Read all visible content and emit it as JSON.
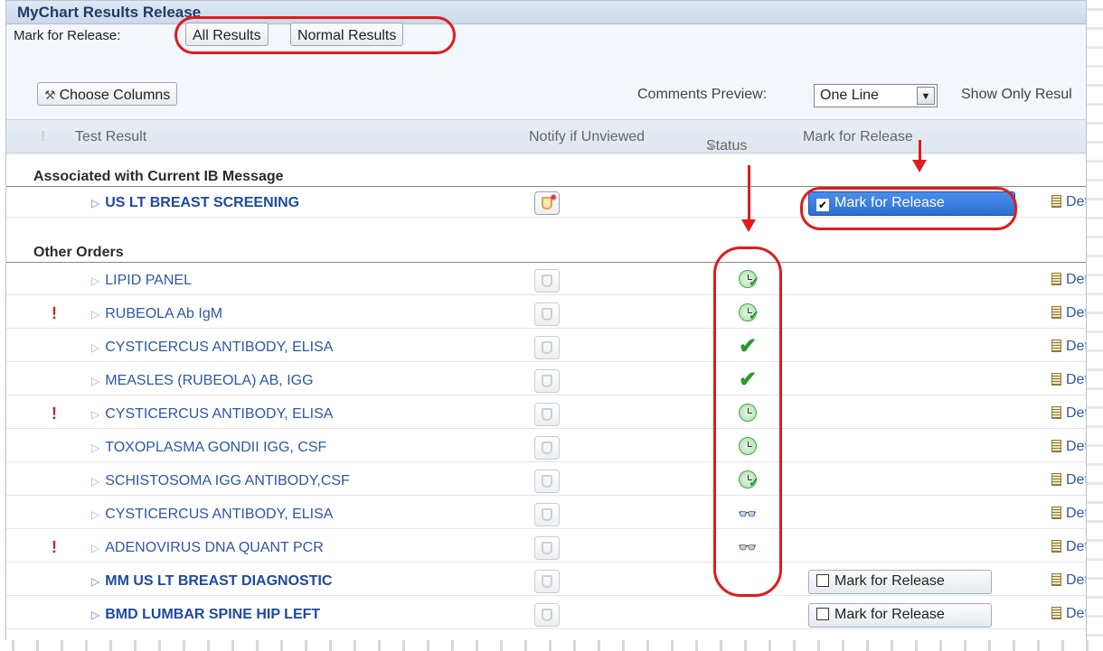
{
  "window": {
    "title": "MyChart Results Release"
  },
  "toolbar": {
    "mark_label": "Mark for Release:",
    "all_results": "All Results",
    "normal_results": "Normal Results",
    "choose_columns": "Choose Columns",
    "comments_label": "Comments Preview:",
    "comments_value": "One Line",
    "show_only": "Show Only Resul"
  },
  "columns": {
    "bang": "!",
    "test_result": "Test Result",
    "notify": "Notify if Unviewed",
    "status": "Status",
    "mark": "Mark for Release"
  },
  "groups": {
    "current": "Associated with Current IB Message",
    "other": "Other Orders"
  },
  "current_rows": [
    {
      "name": "US LT BREAST SCREENING",
      "bold": true,
      "mark_label": "Mark for Release",
      "mark_checked": true,
      "detail": "Deta"
    }
  ],
  "other_rows": [
    {
      "name": "LIPID PANEL",
      "flag": "",
      "status": "clock-check-icon",
      "detail": "Det"
    },
    {
      "name": "RUBEOLA Ab IgM",
      "flag": "!",
      "status": "clock-check-icon",
      "detail": "Deta"
    },
    {
      "name": "CYSTICERCUS ANTIBODY, ELISA",
      "flag": "",
      "status": "checkmark-icon",
      "detail": "Deta"
    },
    {
      "name": "MEASLES (RUBEOLA) AB, IGG",
      "flag": "",
      "status": "checkmark-icon",
      "detail": "Deta"
    },
    {
      "name": "CYSTICERCUS ANTIBODY, ELISA",
      "flag": "!",
      "status": "clock-icon",
      "detail": "Det"
    },
    {
      "name": "TOXOPLASMA GONDII IGG, CSF",
      "flag": "",
      "status": "clock-icon",
      "detail": "Det"
    },
    {
      "name": "SCHISTOSOMA IGG ANTIBODY,CSF",
      "flag": "",
      "status": "clock-check-icon",
      "detail": "Deta"
    },
    {
      "name": "CYSTICERCUS ANTIBODY, ELISA",
      "flag": "",
      "status": "glasses-icon",
      "detail": "Det"
    },
    {
      "name": "ADENOVIRUS DNA QUANT PCR",
      "flag": "!",
      "status": "glasses-icon",
      "detail": "Det"
    },
    {
      "name": "MM US LT BREAST DIAGNOSTIC",
      "flag": "",
      "bold": true,
      "mark_label": "Mark for Release",
      "detail": "Det"
    },
    {
      "name": "BMD LUMBAR SPINE HIP LEFT",
      "flag": "",
      "bold": true,
      "mark_label": "Mark for Release",
      "detail": "Det"
    }
  ],
  "colors": {
    "accent": "#2d6fd6",
    "highlight": "#e01b1b",
    "link": "#2d57a8"
  }
}
